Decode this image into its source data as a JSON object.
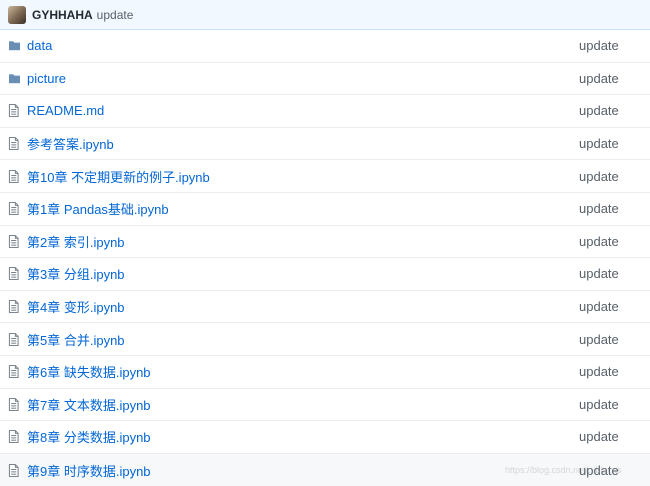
{
  "header": {
    "author": "GYHHAHA",
    "message": "update"
  },
  "files": [
    {
      "name": "data",
      "type": "folder",
      "icon": "folder-icon",
      "message": "update"
    },
    {
      "name": "picture",
      "type": "folder",
      "icon": "folder-icon",
      "message": "update"
    },
    {
      "name": "README.md",
      "type": "file",
      "icon": "file-icon",
      "message": "update"
    },
    {
      "name": "参考答案.ipynb",
      "type": "file",
      "icon": "file-icon",
      "message": "update"
    },
    {
      "name": "第10章 不定期更新的例子.ipynb",
      "type": "file",
      "icon": "file-icon",
      "message": "update"
    },
    {
      "name": "第1章 Pandas基础.ipynb",
      "type": "file",
      "icon": "file-icon",
      "message": "update"
    },
    {
      "name": "第2章 索引.ipynb",
      "type": "file",
      "icon": "file-icon",
      "message": "update"
    },
    {
      "name": "第3章 分组.ipynb",
      "type": "file",
      "icon": "file-icon",
      "message": "update"
    },
    {
      "name": "第4章 变形.ipynb",
      "type": "file",
      "icon": "file-icon",
      "message": "update"
    },
    {
      "name": "第5章 合并.ipynb",
      "type": "file",
      "icon": "file-icon",
      "message": "update"
    },
    {
      "name": "第6章 缺失数据.ipynb",
      "type": "file",
      "icon": "file-icon",
      "message": "update"
    },
    {
      "name": "第7章 文本数据.ipynb",
      "type": "file",
      "icon": "file-icon",
      "message": "update"
    },
    {
      "name": "第8章 分类数据.ipynb",
      "type": "file",
      "icon": "file-icon",
      "message": "update"
    },
    {
      "name": "第9章 时序数据.ipynb",
      "type": "file",
      "icon": "file-icon",
      "message": "update"
    }
  ],
  "watermark": "https://blog.csdn.net/...blacas",
  "colors": {
    "link": "#0366d6",
    "icon": "#6a737d",
    "header_bg": "#f1f8ff",
    "text_muted": "#586069"
  }
}
